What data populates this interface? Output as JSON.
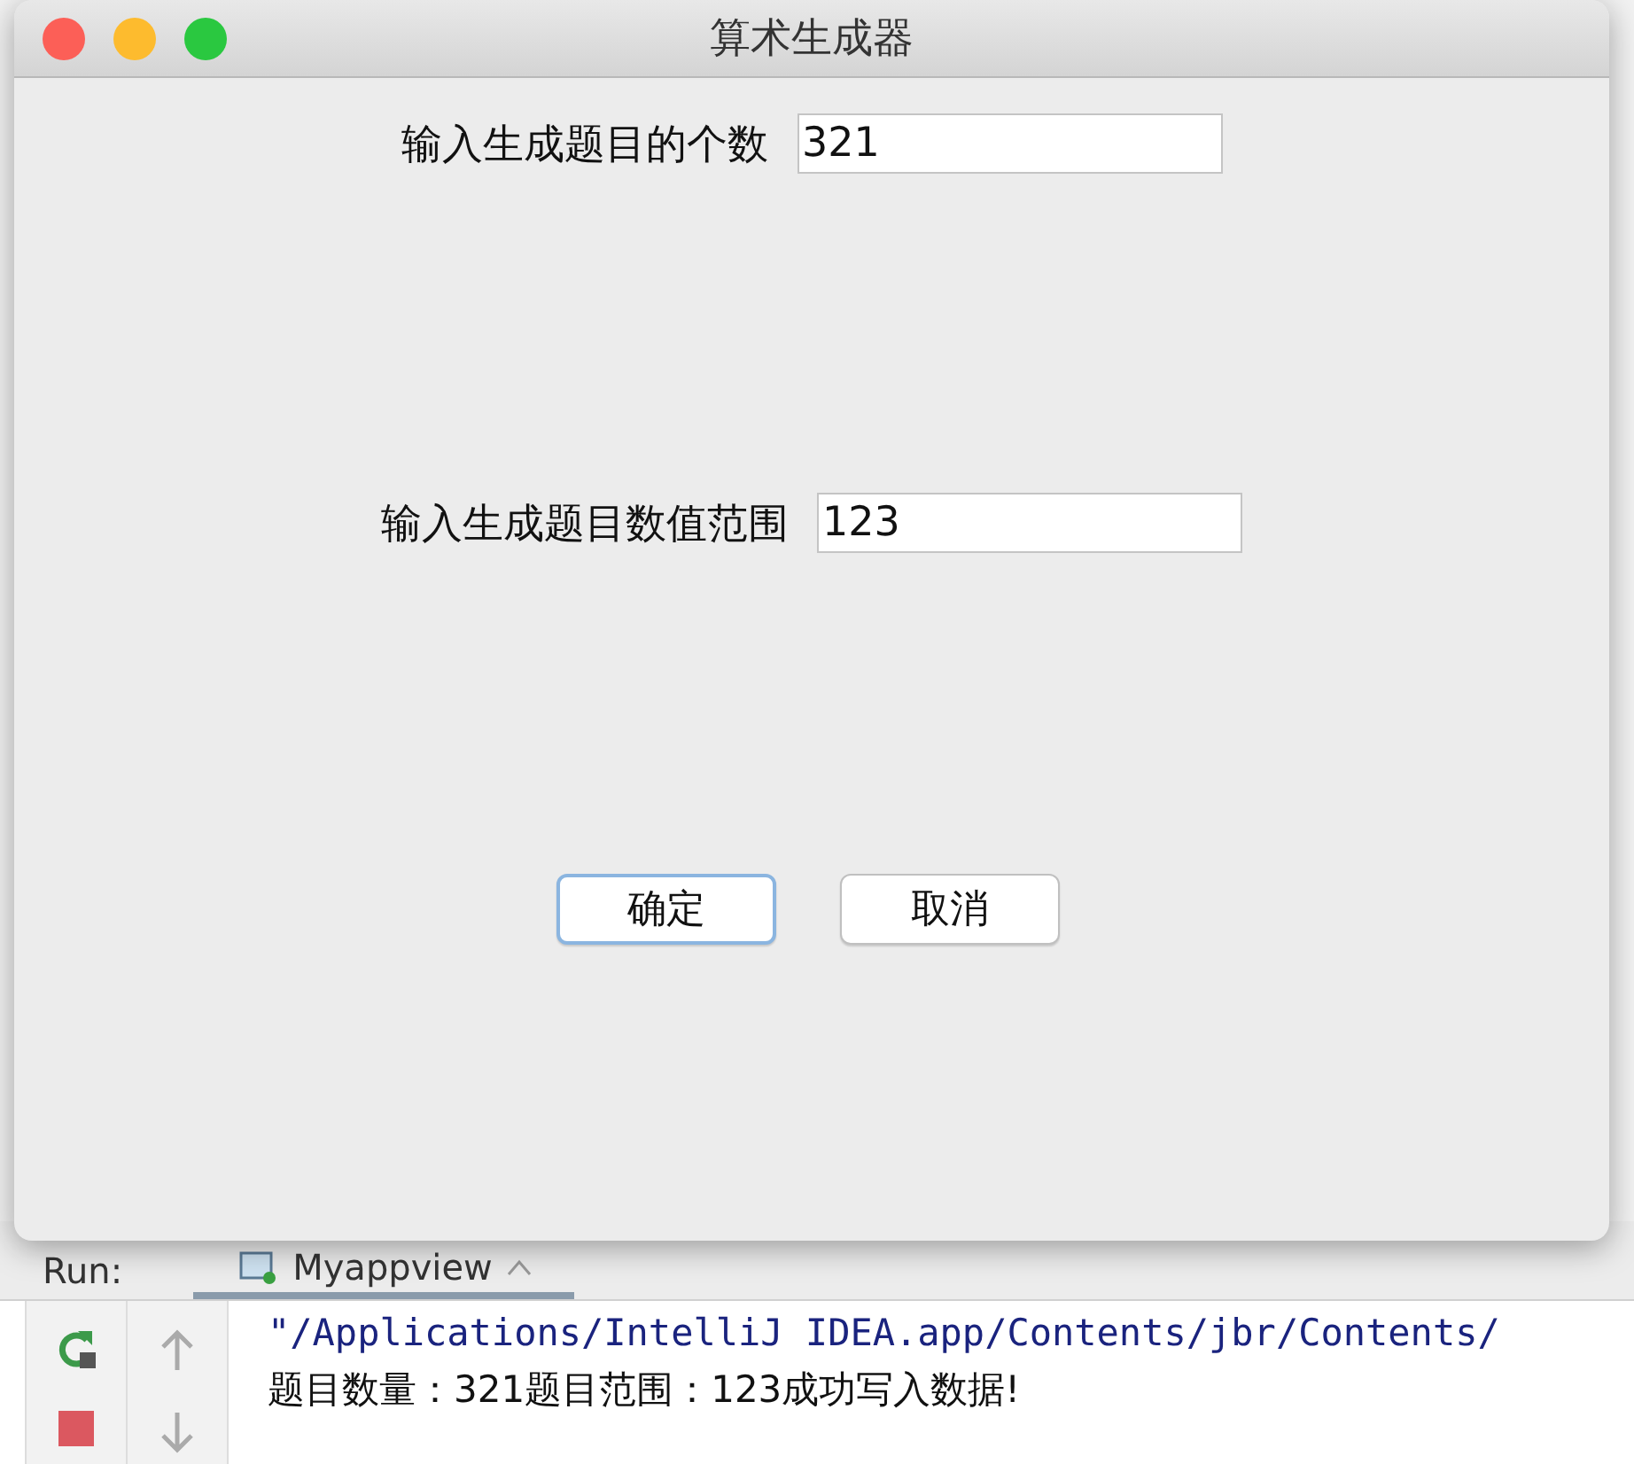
{
  "window": {
    "title": "算术生成器"
  },
  "fields": [
    {
      "label": "输入生成题目的个数",
      "value": "321"
    },
    {
      "label": "输入生成题目数值范围",
      "value": "123"
    }
  ],
  "buttons": [
    {
      "label": "确定",
      "default": true
    },
    {
      "label": "取消",
      "default": false
    }
  ],
  "run_panel": {
    "label": "Run:",
    "tab": {
      "label": "Myappview",
      "selected": true
    },
    "console_lines": [
      {
        "kind": "command",
        "text": "\"/Applications/IntelliJ IDEA.app/Contents/jbr/Contents/"
      },
      {
        "kind": "output",
        "text": "题目数量：321题目范围：123成功写入数据!"
      }
    ]
  }
}
